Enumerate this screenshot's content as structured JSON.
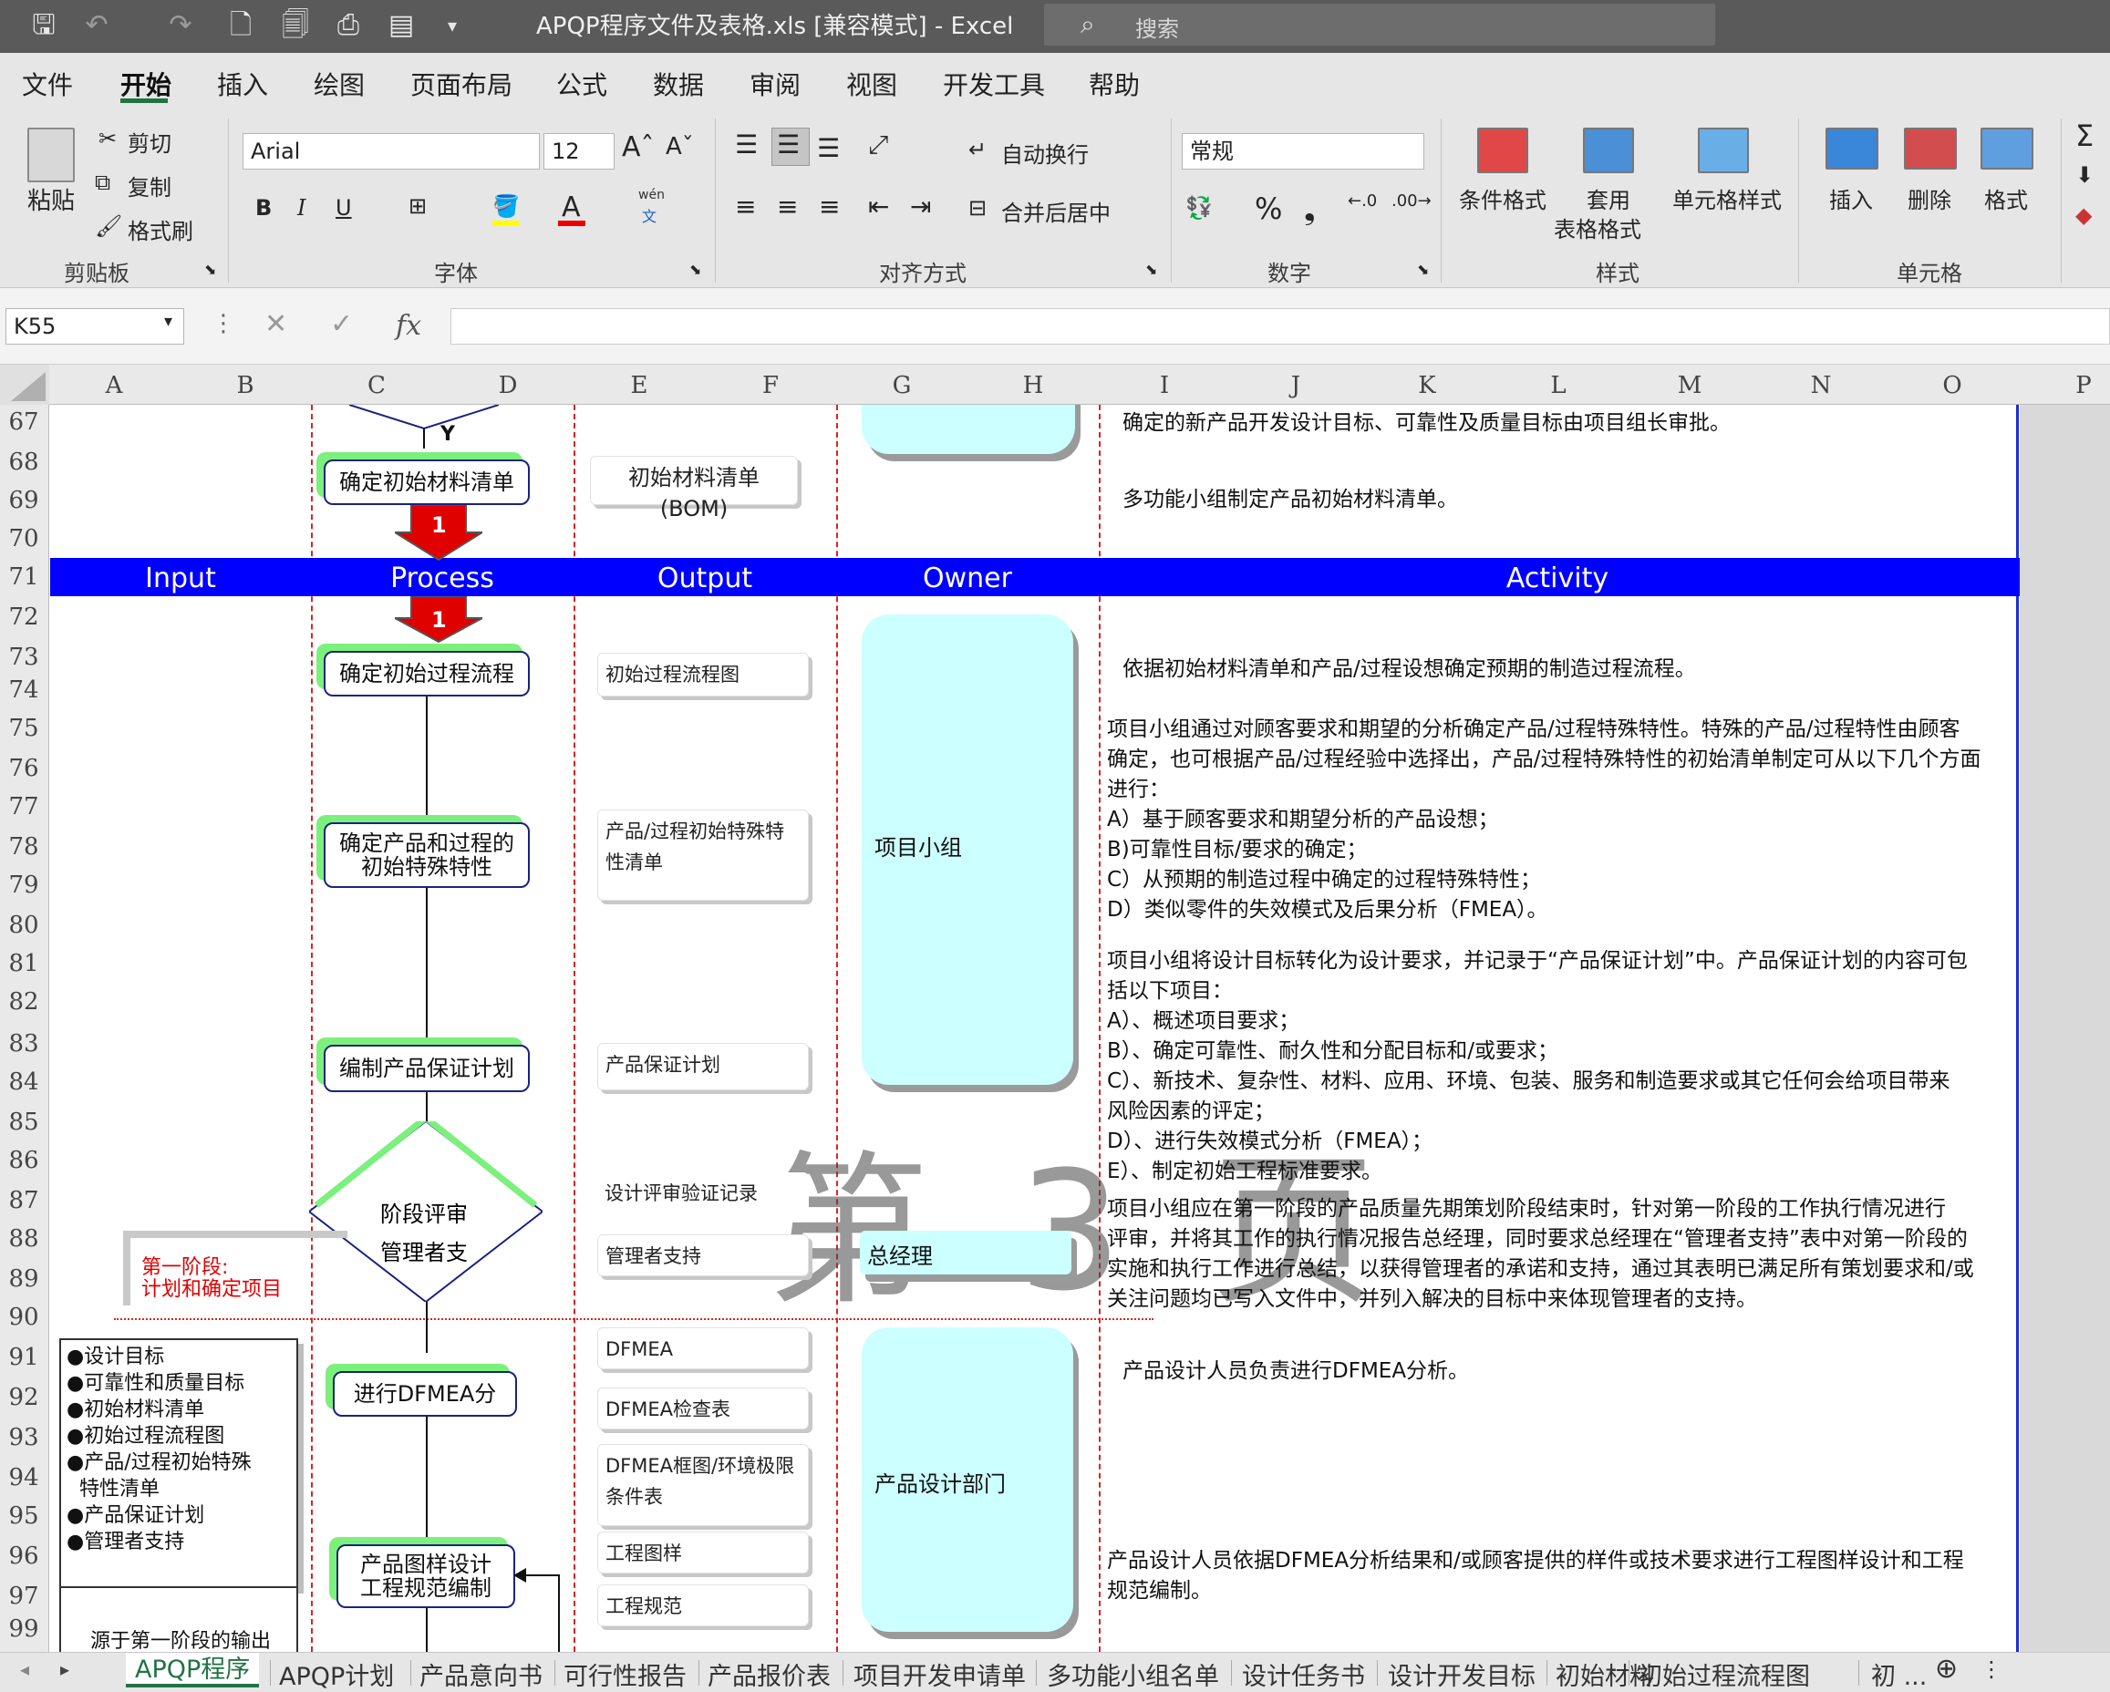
{
  "window": {
    "title": "APQP程序文件及表格.xls  [兼容模式]  -  Excel",
    "search_placeholder": "搜索"
  },
  "menu_tabs": [
    "文件",
    "开始",
    "插入",
    "绘图",
    "页面布局",
    "公式",
    "数据",
    "审阅",
    "视图",
    "开发工具",
    "帮助"
  ],
  "ribbon": {
    "clipboard": {
      "paste": "粘贴",
      "cut": "剪切",
      "copy": "复制",
      "format_painter": "格式刷",
      "group": "剪贴板"
    },
    "font": {
      "name": "Arial",
      "size": "12",
      "wen": "wén",
      "wen2": "文",
      "group": "字体"
    },
    "alignment": {
      "wrap": "自动换行",
      "merge": "合并后居中",
      "group": "对齐方式"
    },
    "number": {
      "format": "常规",
      "group": "数字"
    },
    "styles": {
      "conditional": "条件格式",
      "table_line1": "套用",
      "table_line2": "表格格式",
      "cell_styles": "单元格样式",
      "group": "样式"
    },
    "cells": {
      "insert": "插入",
      "delete": "删除",
      "format": "格式",
      "group": "单元格"
    }
  },
  "formula_bar": {
    "name_box": "K55",
    "fx": "fx"
  },
  "columns": [
    "A",
    "B",
    "C",
    "D",
    "E",
    "F",
    "G",
    "H",
    "I",
    "J",
    "K",
    "L",
    "M",
    "N",
    "O",
    "P"
  ],
  "rows": [
    "67",
    "68",
    "69",
    "70",
    "71",
    "72",
    "73",
    "74",
    "75",
    "76",
    "77",
    "78",
    "79",
    "80",
    "81",
    "82",
    "83",
    "84",
    "85",
    "86",
    "87",
    "88",
    "89",
    "90",
    "91",
    "92",
    "93",
    "94",
    "95",
    "96",
    "97",
    "98",
    "99"
  ],
  "header_band": {
    "input": "Input",
    "process": "Process",
    "output": "Output",
    "owner": "Owner",
    "activity": "Activity"
  },
  "flow": {
    "proc_bom": "确定初始材料清单",
    "proc_flow": "确定初始过程流程",
    "proc_char_1": "确定产品和过程的",
    "proc_char_2": "初始特殊特性",
    "proc_plan": "编制产品保证计划",
    "diamond_1": "阶段评审",
    "diamond_2": "管理者支",
    "proc_dfmea": "进行DFMEA分",
    "proc_draw_1": "产品图样设计",
    "proc_draw_2": "工程规范编制",
    "connector": "1",
    "merge_y": "Y"
  },
  "outputs": {
    "bom": "初始材料清单(BOM)",
    "flowchart": "初始过程流程图",
    "char_list_1": "产品/过程初始特殊特",
    "char_list_2": "性清单",
    "assurance": "产品保证计划",
    "review": "设计评审验证记录",
    "mgmt": "管理者支持",
    "dfmea": "DFMEA",
    "dfmea_check": "DFMEA检查表",
    "dfmea_frame_1": "DFMEA框图/环境极限",
    "dfmea_frame_2": "条件表",
    "drawings": "工程图样",
    "specs": "工程规范"
  },
  "owners": {
    "team": "项目小组",
    "gm": "总经理",
    "design": "产品设计部门"
  },
  "stage_label": {
    "line1": "第一阶段:",
    "line2": "计划和确定项目"
  },
  "inputs_list": [
    "●设计目标",
    "●可靠性和质量目标",
    "●初始材料清单",
    "●初始过程流程图",
    "●产品/过程初始特殊",
    "  特性清单",
    "●产品保证计划",
    "●管理者支持"
  ],
  "inputs_source": "源于第一阶段的输出",
  "watermark": "第 3 页",
  "activities": [
    "确定的新产品开发设计目标、可靠性及质量目标由项目组长审批。",
    "多功能小组制定产品初始材料清单。",
    "依据初始材料清单和产品/过程设想确定预期的制造过程流程。",
    "  项目小组通过对顾客要求和期望的分析确定产品/过程特殊特性。特殊的产品/过程特性由顾客",
    "确定，也可根据产品/过程经验中选择出，产品/过程特殊特性的初始清单制定可从以下几个方面",
    "进行：",
    "  A）基于顾客要求和期望分析的产品设想；",
    "  B)可靠性目标/要求的确定；",
    "  C）从预期的制造过程中确定的过程特殊特性；",
    "  D）类似零件的失效模式及后果分析（FMEA）。",
    "  项目小组将设计目标转化为设计要求，并记录于“产品保证计划”中。产品保证计划的内容可包",
    "括以下项目：",
    "  A）、概述项目要求；",
    "  B）、确定可靠性、耐久性和分配目标和/或要求；",
    "  C）、新技术、复杂性、材料、应用、环境、包装、服务和制造要求或其它任何会给项目带来",
    "风险因素的评定；",
    "  D）、进行失效模式分析（FMEA）；",
    "  E）、制定初始工程标准要求。",
    "  项目小组应在第一阶段的产品质量先期策划阶段结束时，针对第一阶段的工作执行情况进行",
    "评审，并将其工作的执行情况报告总经理，同时要求总经理在“管理者支持”表中对第一阶段的",
    "实施和执行工作进行总结，以获得管理者的承诺和支持，通过其表明已满足所有策划要求和/或",
    "关注问题均已写入文件中，并列入解决的目标中来体现管理者的支持。",
    "产品设计人员负责进行DFMEA分析。",
    "  产品设计人员依据DFMEA分析结果和/或顾客提供的样件或技术要求进行工程图样设计和工程",
    "规范编制。"
  ],
  "sheet_tabs": [
    "APQP程序",
    "APQP计划",
    "产品意向书",
    "可行性报告",
    "产品报价表",
    "项目开发申请单",
    "多功能小组名单",
    "设计任务书",
    "设计开发目标",
    "初始材料",
    "初始过程流程图",
    "初 ..."
  ],
  "colors": {
    "accent": "#217346",
    "header_band": "#0000ff",
    "owner_fill": "#ccffff",
    "process_shadow": "#7cf07c",
    "guide": "#dd2222"
  }
}
